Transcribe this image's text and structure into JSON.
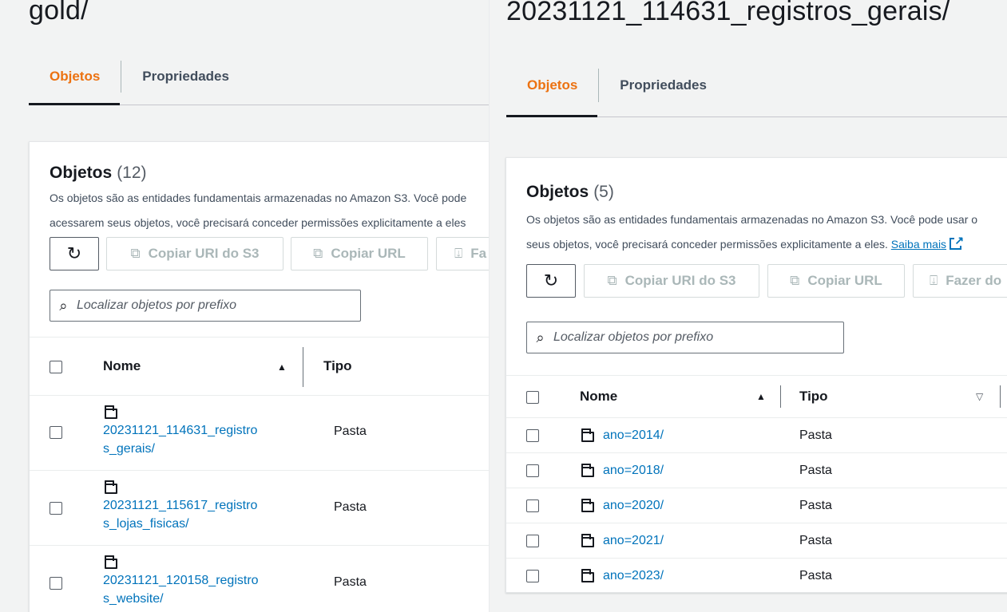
{
  "left": {
    "title": "gold/",
    "tabs": [
      "Objetos",
      "Propriedades"
    ],
    "card": {
      "heading": "Objetos",
      "count": "(12)",
      "desc_line1": "Os objetos são as entidades fundamentais armazenadas no Amazon S3. Você pode",
      "desc_line2": "acessarem seus objetos, você precisará conceder permissões explicitamente a eles",
      "buttons": {
        "copy_uri": "Copiar URI do S3",
        "copy_url": "Copiar URL",
        "download": "Fa"
      },
      "search_placeholder": "Localizar objetos por prefixo",
      "columns": {
        "name": "Nome",
        "type": "Tipo"
      },
      "rows": [
        {
          "name_l1": "20231121_114631_registro",
          "name_l2": "s_gerais/",
          "type": "Pasta"
        },
        {
          "name_l1": "20231121_115617_registro",
          "name_l2": "s_lojas_fisicas/",
          "type": "Pasta"
        },
        {
          "name_l1": "20231121_120158_registro",
          "name_l2": "s_website/",
          "type": "Pasta"
        }
      ]
    }
  },
  "right": {
    "title": "20231121_114631_registros_gerais/",
    "tabs": [
      "Objetos",
      "Propriedades"
    ],
    "card": {
      "heading": "Objetos",
      "count": "(5)",
      "desc_line1": "Os objetos são as entidades fundamentais armazenadas no Amazon S3. Você pode usar o",
      "desc_line2": "seus objetos, você precisará conceder permissões explicitamente a eles.",
      "learn_more": "Saiba mais",
      "buttons": {
        "copy_uri": "Copiar URI do S3",
        "copy_url": "Copiar URL",
        "download": "Fazer do"
      },
      "search_placeholder": "Localizar objetos por prefixo",
      "columns": {
        "name": "Nome",
        "type": "Tipo"
      },
      "rows": [
        {
          "name": "ano=2014/",
          "type": "Pasta"
        },
        {
          "name": "ano=2018/",
          "type": "Pasta"
        },
        {
          "name": "ano=2020/",
          "type": "Pasta"
        },
        {
          "name": "ano=2021/",
          "type": "Pasta"
        },
        {
          "name": "ano=2023/",
          "type": "Pasta"
        }
      ]
    }
  },
  "colors": {
    "accent": "#ec7211",
    "link": "#0073bb",
    "text": "#16191f"
  },
  "icons": [
    "refresh-icon",
    "copy-icon",
    "download-icon",
    "search-icon",
    "folder-icon",
    "sort-ascending-icon",
    "sort-descending-icon",
    "external-link-icon"
  ]
}
